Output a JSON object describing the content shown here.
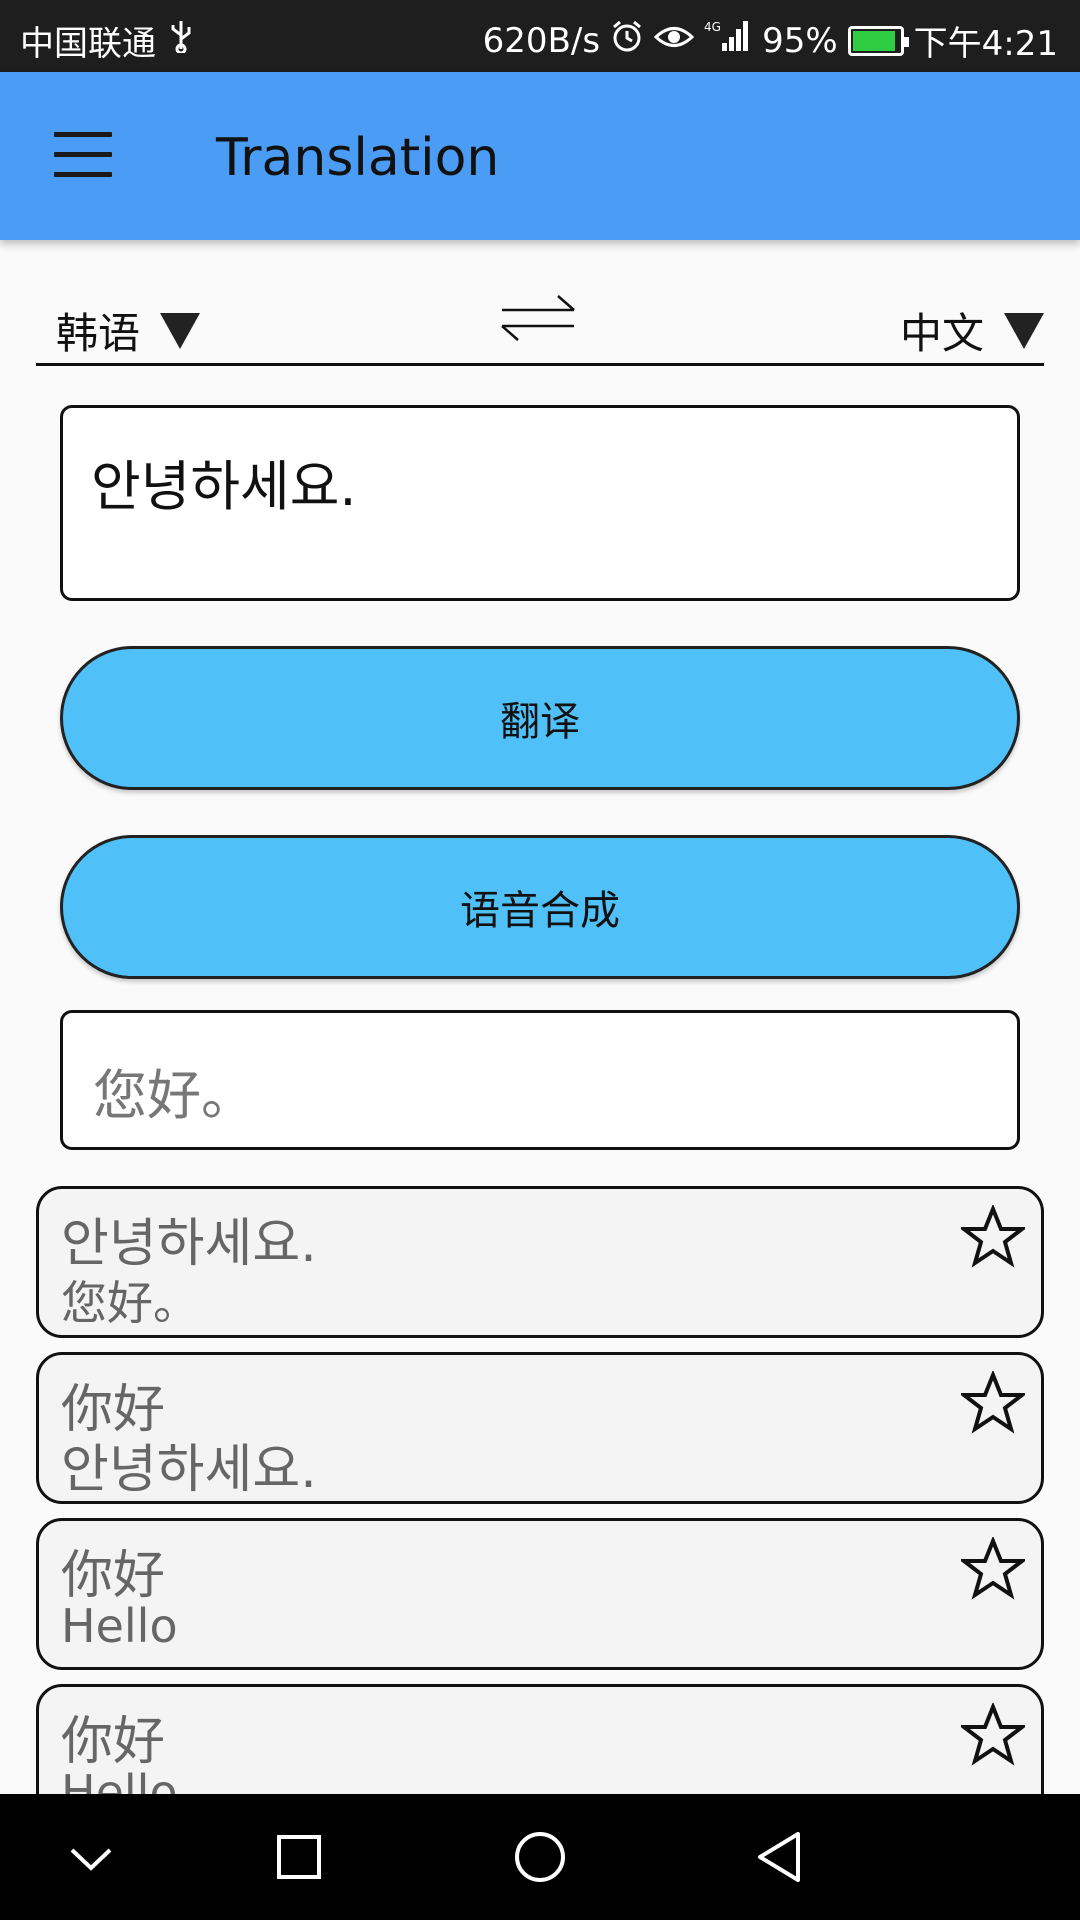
{
  "status_bar": {
    "carrier": "中国联通",
    "net_speed": "620B/s",
    "signal_label": "4G",
    "battery_percent": "95%",
    "time": "下午4:21"
  },
  "app_bar": {
    "title": "Translation"
  },
  "language_selector": {
    "source_language": "韩语",
    "target_language": "中文"
  },
  "input": {
    "value": "안녕하세요."
  },
  "buttons": {
    "translate_label": "翻译",
    "speech_label": "语音合成"
  },
  "output": {
    "value": "您好。"
  },
  "history": [
    {
      "source": "안녕하세요.",
      "translation": "您好。"
    },
    {
      "source": "你好",
      "translation": "안녕하세요."
    },
    {
      "source": "你好",
      "translation": "Hello"
    },
    {
      "source": "你好",
      "translation": "Hello"
    }
  ],
  "colors": {
    "app_bar": "#4a9cf5",
    "button": "#4fc1f8",
    "status_bar": "#1e1e1e",
    "nav_bar": "#000000"
  }
}
